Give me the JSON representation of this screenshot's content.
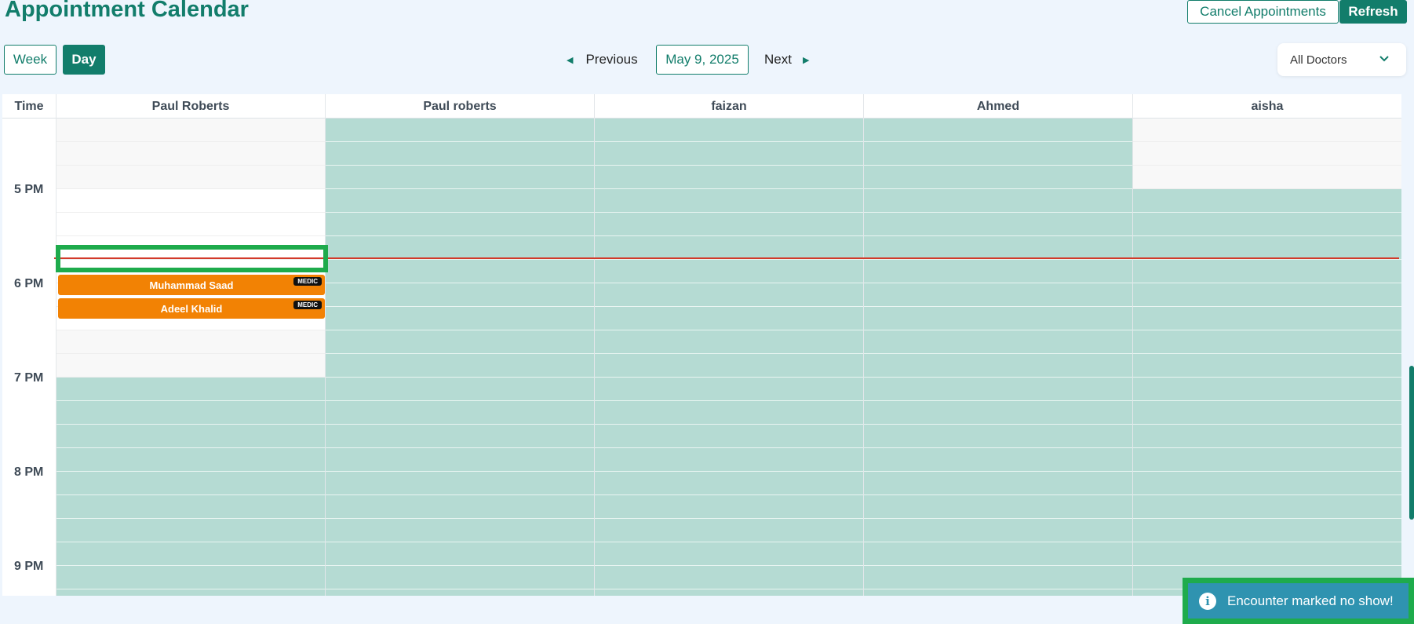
{
  "header": {
    "title": "Appointment Calendar",
    "cancel_label": "Cancel Appointments",
    "refresh_label": "Refresh"
  },
  "toolbar": {
    "week_label": "Week",
    "day_label": "Day",
    "previous_label": "Previous",
    "date": "May 9, 2025",
    "next_label": "Next",
    "doctor_filter": "All Doctors"
  },
  "calendar": {
    "time_header": "Time",
    "doctors": [
      "Paul Roberts",
      "Paul roberts",
      "faizan",
      "Ahmed",
      "aisha"
    ],
    "time_labels": [
      "5 PM",
      "6 PM",
      "7 PM",
      "8 PM",
      "9 PM"
    ],
    "events": [
      {
        "patient": "Muhammad Saad",
        "tag": "MEDIC"
      },
      {
        "patient": "Adeel Khalid",
        "tag": "MEDIC"
      }
    ]
  },
  "toast": {
    "message": "Encounter marked no show!"
  },
  "colors": {
    "primary": "#127d6b",
    "unavailable_slot": "#b5dbd3",
    "event": "#f28204",
    "now_line": "#d23a2a",
    "toast": "#2f93b0",
    "highlight": "#1eab4c"
  }
}
